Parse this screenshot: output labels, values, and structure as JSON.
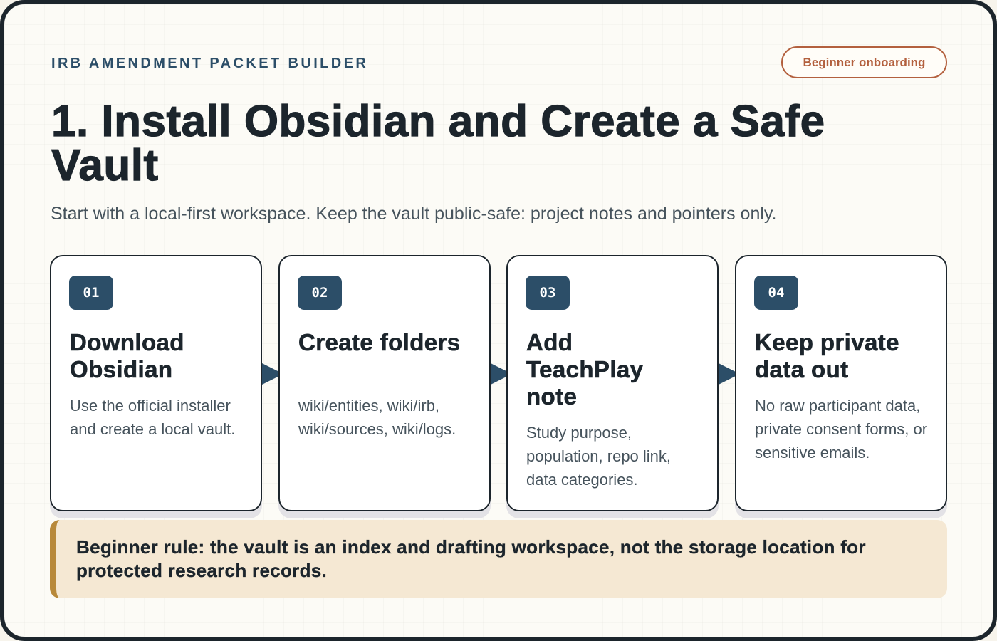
{
  "header": {
    "eyebrow": "IRB AMENDMENT PACKET BUILDER",
    "badge": "Beginner onboarding"
  },
  "title": "1. Install Obsidian and Create a Safe Vault",
  "subtitle": "Start with a local-first workspace. Keep the vault public-safe: project notes and pointers only.",
  "steps": [
    {
      "number": "01",
      "title": "Download Obsidian",
      "description": "Use the official installer and create a local vault."
    },
    {
      "number": "02",
      "title": "Create folders",
      "description": "wiki/entities, wiki/irb, wiki/sources, wiki/logs."
    },
    {
      "number": "03",
      "title": "Add TeachPlay note",
      "description": "Study purpose, population, repo link, data categories."
    },
    {
      "number": "04",
      "title": "Keep private data out",
      "description": "No raw participant data, private consent forms, or sensitive emails."
    }
  ],
  "rule": "Beginner rule: the vault is an index and drafting workspace, not the storage location for protected research records.",
  "colors": {
    "navy": "#2c4e68",
    "ink": "#1c252c",
    "accent": "#b3603e",
    "rule_bar": "#b8893a",
    "rule_bg": "#f5e8d3"
  },
  "icons": [
    "arrow-right-icon"
  ]
}
